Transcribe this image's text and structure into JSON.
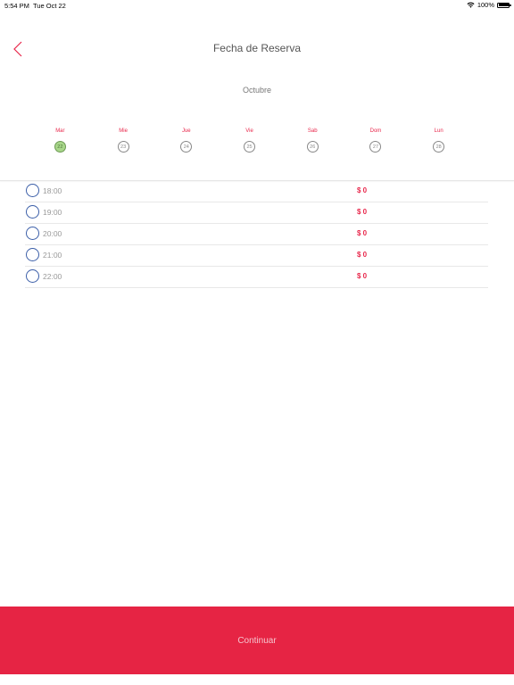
{
  "status_bar": {
    "time": "5:54 PM",
    "date": "Tue Oct 22",
    "battery": "100%"
  },
  "header": {
    "title": "Fecha de Reserva"
  },
  "calendar": {
    "month": "Octubre",
    "selected_color": "#a8d68a",
    "days": [
      {
        "name": "Mar",
        "number": "22",
        "selected": true
      },
      {
        "name": "Mie",
        "number": "23",
        "selected": false
      },
      {
        "name": "Jue",
        "number": "24",
        "selected": false
      },
      {
        "name": "Vie",
        "number": "25",
        "selected": false
      },
      {
        "name": "Sab",
        "number": "26",
        "selected": false
      },
      {
        "name": "Dom",
        "number": "27",
        "selected": false
      },
      {
        "name": "Lun",
        "number": "28",
        "selected": false
      }
    ]
  },
  "slots": [
    {
      "time": "18:00",
      "price": "$ 0"
    },
    {
      "time": "19:00",
      "price": "$ 0"
    },
    {
      "time": "20:00",
      "price": "$ 0"
    },
    {
      "time": "21:00",
      "price": "$ 0"
    },
    {
      "time": "22:00",
      "price": "$ 0"
    }
  ],
  "footer": {
    "continue_label": "Continuar"
  },
  "colors": {
    "accent": "#e62444",
    "radio": "#3b5ea8"
  }
}
